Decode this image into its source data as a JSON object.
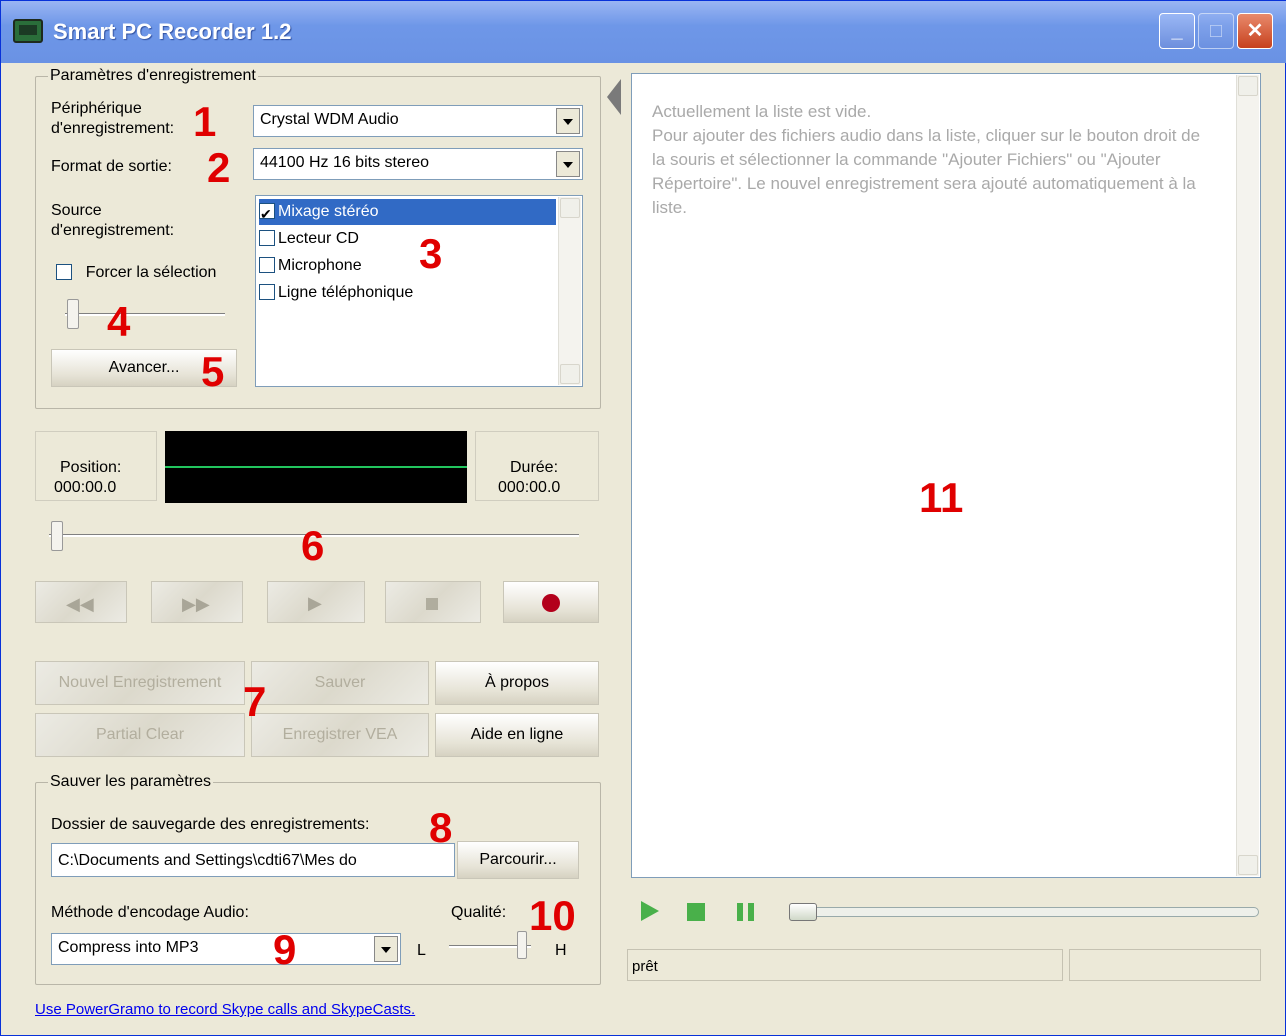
{
  "window": {
    "title": "Smart PC Recorder 1.2"
  },
  "settings_group": {
    "legend": "Paramètres d'enregistrement",
    "device_label": "Périphérique\nd'enregistrement:",
    "device_value": "Crystal WDM Audio",
    "format_label": "Format de sortie:",
    "format_value": "44100 Hz 16 bits stereo",
    "source_label": "Source\nd'enregistrement:",
    "force_label": "Forcer la sélection",
    "force_checked": false,
    "sources": [
      {
        "label": "Mixage stéréo",
        "checked": true,
        "selected": true
      },
      {
        "label": "Lecteur CD",
        "checked": false,
        "selected": false
      },
      {
        "label": "Microphone",
        "checked": false,
        "selected": false
      },
      {
        "label": "Ligne téléphonique",
        "checked": false,
        "selected": false
      }
    ],
    "advanced_button": "Avancer..."
  },
  "meter": {
    "position_label": "Position:",
    "position_value": "000:00.0",
    "duration_label": "Durée:",
    "duration_value": "000:00.0"
  },
  "actions": {
    "new_recording": "Nouvel Enregistrement",
    "save": "Sauver",
    "about": "À propos",
    "partial_clear": "Partial Clear",
    "save_vea": "Enregistrer VEA",
    "online_help": "Aide en ligne"
  },
  "save_group": {
    "legend": "Sauver les paramètres",
    "folder_label": "Dossier de sauvegarde des enregistrements:",
    "folder_value": "C:\\Documents and Settings\\cdti67\\Mes do",
    "browse_button": "Parcourir...",
    "encoding_label": "Méthode d'encodage Audio:",
    "encoding_value": "Compress into MP3",
    "quality_label": "Qualité:",
    "quality_low": "L",
    "quality_high": "H"
  },
  "playlist": {
    "empty_text": "Actuellement la liste est vide.\nPour ajouter des fichiers audio dans la liste, cliquer sur le bouton droit de la souris et sélectionner la commande \"Ajouter Fichiers\" ou \"Ajouter Répertoire\". Le nouvel enregistrement sera ajouté automatiquement à la liste."
  },
  "status": {
    "text": "prêt"
  },
  "footer_link": "Use PowerGramo to record Skype calls and SkypeCasts.",
  "annotations": {
    "n1": "1",
    "n2": "2",
    "n3": "3",
    "n4": "4",
    "n5": "5",
    "n6": "6",
    "n7": "7",
    "n8": "8",
    "n9": "9",
    "n10": "10",
    "n11": "11"
  },
  "colors": {
    "annotation": "#e00000",
    "selection": "#316ac5",
    "play_green": "#49b04a"
  }
}
